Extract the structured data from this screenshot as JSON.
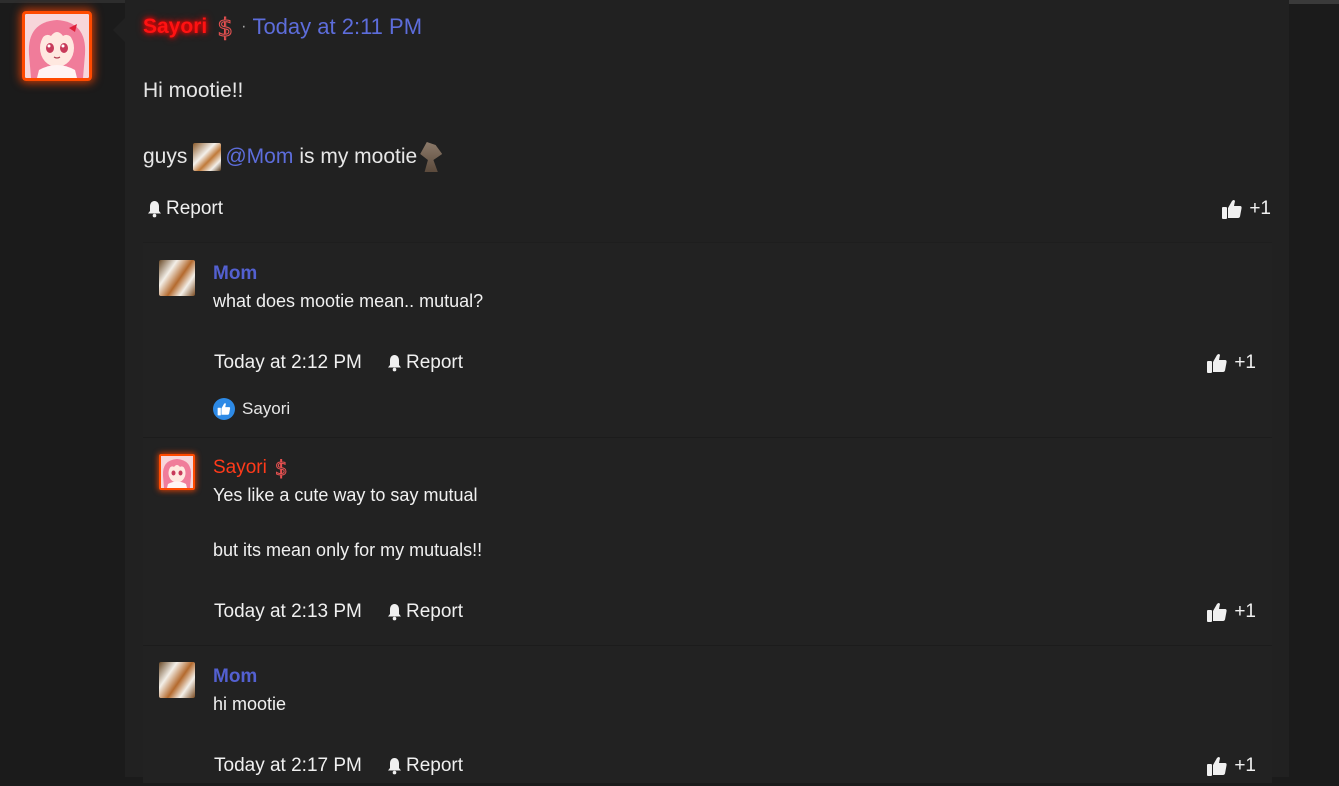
{
  "post": {
    "author": "Sayori",
    "separator": "·",
    "timestamp": "Today at 2:11 PM",
    "body_line1": "Hi mootie!!",
    "body_line2_prefix": "guys",
    "mention": "@Mom",
    "body_line2_suffix": "is my mootie",
    "report_label": "Report",
    "like_label": "+1"
  },
  "replies": [
    {
      "author": "Mom",
      "lines": [
        "what does mootie mean.. mutual?"
      ],
      "timestamp": "Today at 2:12 PM",
      "report_label": "Report",
      "like_label": "+1",
      "reactor": "Sayori"
    },
    {
      "author": "Sayori",
      "lines": [
        "Yes like a cute way to say mutual",
        "but its mean only for my mutuals!!"
      ],
      "timestamp": "Today at 2:13 PM",
      "report_label": "Report",
      "like_label": "+1"
    },
    {
      "author": "Mom",
      "lines": [
        "hi mootie"
      ],
      "timestamp": "Today at 2:17 PM",
      "report_label": "Report",
      "like_label": "+1"
    }
  ],
  "icons": {
    "report": "bell-icon",
    "like": "thumbs-up-icon",
    "badge": "dollar-icon",
    "reaction": "like-reaction-icon"
  },
  "colors": {
    "background": "#1b1b1b",
    "panel": "#212121",
    "link_blue": "#5d6ddb",
    "sayori_red": "#ff1212",
    "avatar_glow": "#ff4a00",
    "reaction_blue": "#2d8ae6"
  }
}
